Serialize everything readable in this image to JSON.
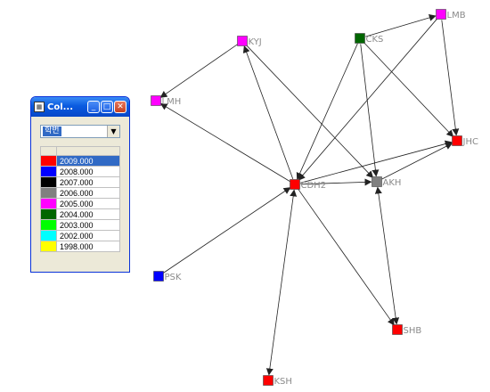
{
  "legend_window": {
    "title": "Col...",
    "dropdown_value": "학번",
    "items": [
      {
        "color": "#ff0000",
        "label": "2009.000",
        "selected": true
      },
      {
        "color": "#0000ff",
        "label": "2008.000",
        "selected": false
      },
      {
        "color": "#000000",
        "label": "2007.000",
        "selected": false
      },
      {
        "color": "#808080",
        "label": "2006.000",
        "selected": false
      },
      {
        "color": "#ff00ff",
        "label": "2005.000",
        "selected": false
      },
      {
        "color": "#006600",
        "label": "2004.000",
        "selected": false
      },
      {
        "color": "#00ff00",
        "label": "2003.000",
        "selected": false
      },
      {
        "color": "#00ffff",
        "label": "2002.000",
        "selected": false
      },
      {
        "color": "#ffff00",
        "label": "1998.000",
        "selected": false
      }
    ]
  },
  "graph": {
    "nodes": [
      {
        "id": "LMB",
        "label": "LMB",
        "color": "#ff00ff"
      },
      {
        "id": "CKS",
        "label": "CKS",
        "color": "#006600"
      },
      {
        "id": "KYJ",
        "label": "KYJ",
        "color": "#ff00ff"
      },
      {
        "id": "LMH",
        "label": "LMH",
        "color": "#ff00ff"
      },
      {
        "id": "JHC",
        "label": "JHC",
        "color": "#ff0000"
      },
      {
        "id": "CDH2",
        "label": "CDH2",
        "color": "#ff0000"
      },
      {
        "id": "AKH",
        "label": "AKH",
        "color": "#808080"
      },
      {
        "id": "PSK",
        "label": "PSK",
        "color": "#0000ff"
      },
      {
        "id": "SHB",
        "label": "SHB",
        "color": "#ff0000"
      },
      {
        "id": "KSH",
        "label": "KSH",
        "color": "#ff0000"
      }
    ],
    "edges": [
      {
        "from": "CKS",
        "to": "LMB",
        "directed": true,
        "both": false
      },
      {
        "from": "LMB",
        "to": "JHC",
        "directed": true,
        "both": false
      },
      {
        "from": "CKS",
        "to": "JHC",
        "directed": true,
        "both": false
      },
      {
        "from": "CKS",
        "to": "CDH2",
        "directed": true,
        "both": false
      },
      {
        "from": "CKS",
        "to": "AKH",
        "directed": true,
        "both": false
      },
      {
        "from": "LMB",
        "to": "CDH2",
        "directed": true,
        "both": false
      },
      {
        "from": "KYJ",
        "to": "LMH",
        "directed": true,
        "both": false
      },
      {
        "from": "CDH2",
        "to": "KYJ",
        "directed": true,
        "both": false
      },
      {
        "from": "CDH2",
        "to": "LMH",
        "directed": true,
        "both": false
      },
      {
        "from": "KYJ",
        "to": "AKH",
        "directed": true,
        "both": false
      },
      {
        "from": "CDH2",
        "to": "AKH",
        "directed": true,
        "both": false
      },
      {
        "from": "CDH2",
        "to": "JHC",
        "directed": true,
        "both": false
      },
      {
        "from": "AKH",
        "to": "JHC",
        "directed": true,
        "both": false
      },
      {
        "from": "PSK",
        "to": "CDH2",
        "directed": true,
        "both": false
      },
      {
        "from": "CDH2",
        "to": "SHB",
        "directed": true,
        "both": false
      },
      {
        "from": "AKH",
        "to": "SHB",
        "directed": true,
        "both": true
      },
      {
        "from": "CDH2",
        "to": "KSH",
        "directed": true,
        "both": true
      }
    ]
  }
}
